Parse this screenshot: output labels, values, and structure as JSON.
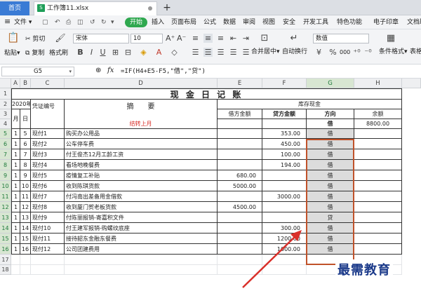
{
  "tabs": {
    "home": "首页",
    "document": "工作簿11.xlsx",
    "add": "+"
  },
  "menu": {
    "hamburger": "≡",
    "file": "文件",
    "items": [
      "开始",
      "插入",
      "页面布局",
      "公式",
      "数据",
      "审阅",
      "视图",
      "安全",
      "开发工具",
      "特色功能",
      "电子印章",
      "文档助"
    ]
  },
  "toolbar": {
    "paste": "粘贴",
    "cut": "剪切",
    "copy": "复制",
    "format_painter": "格式刷",
    "font_name": "宋体",
    "font_size": "10",
    "bold": "B",
    "italic": "I",
    "underline": "U",
    "merge_center": "合并居中",
    "wrap_text": "自动换行",
    "number_format": "数值",
    "percent": "%",
    "thousands": "000",
    "conditional_format": "条件格式",
    "more_format": "表格"
  },
  "formula_bar": {
    "cell_ref": "G5",
    "fx": "fx",
    "formula": "=IF(H4+E5-F5,\"借\",\"贷\")"
  },
  "sheet": {
    "columns": [
      "A",
      "B",
      "C",
      "D",
      "E",
      "F",
      "G",
      "H"
    ],
    "row_numbers": [
      "1",
      "2",
      "3",
      "4",
      "5",
      "6",
      "7",
      "8",
      "9",
      "10",
      "11",
      "12",
      "13",
      "14",
      "15",
      "16",
      "17",
      "18"
    ],
    "title": "现 金 日 记 账",
    "header": {
      "year": "2020年",
      "month": "月",
      "day": "日",
      "voucher": "凭证编号",
      "summary": "摘　　要",
      "ledger": "库存现金",
      "debit": "借方金额",
      "credit": "贷方金额",
      "direction": "方向",
      "balance": "余额"
    },
    "carry_forward": {
      "label": "结转上月",
      "direction": "借",
      "balance": "8800.00"
    },
    "rows": [
      {
        "month": "1",
        "day": "5",
        "voucher": "现付1",
        "summary": "购买办公用品",
        "debit": "",
        "credit": "353.00",
        "direction": "借"
      },
      {
        "month": "1",
        "day": "6",
        "voucher": "现付2",
        "summary": "公车停车费",
        "debit": "",
        "credit": "450.00",
        "direction": "借"
      },
      {
        "month": "1",
        "day": "7",
        "voucher": "现付3",
        "summary": "付王俊杰12月工龄工资",
        "debit": "",
        "credit": "100.00",
        "direction": "借"
      },
      {
        "month": "1",
        "day": "8",
        "voucher": "现付4",
        "summary": "看场地晚餐费",
        "debit": "",
        "credit": "194.00",
        "direction": "借"
      },
      {
        "month": "1",
        "day": "9",
        "voucher": "现付5",
        "summary": "疫情复工补贴",
        "debit": "680.00",
        "credit": "",
        "direction": "借"
      },
      {
        "month": "1",
        "day": "10",
        "voucher": "现付6",
        "summary": "收到陈琪货款",
        "debit": "5000.00",
        "credit": "",
        "direction": "借"
      },
      {
        "month": "1",
        "day": "11",
        "voucher": "现付7",
        "summary": "付冯南出差备用金借款",
        "debit": "",
        "credit": "3000.00",
        "direction": "借"
      },
      {
        "month": "1",
        "day": "12",
        "voucher": "现付8",
        "summary": "收到厦门贺老板货款",
        "debit": "4500.00",
        "credit": "",
        "direction": "借"
      },
      {
        "month": "1",
        "day": "13",
        "voucher": "现付9",
        "summary": "付陈丽报销-寄嘉积文件",
        "debit": "",
        "credit": "",
        "direction": "贷"
      },
      {
        "month": "1",
        "day": "14",
        "voucher": "现付10",
        "summary": "付王建军报销-购螺纹底座",
        "debit": "",
        "credit": "300.00",
        "direction": "借"
      },
      {
        "month": "1",
        "day": "15",
        "voucher": "现付11",
        "summary": "接待韶东金融东餐费",
        "debit": "",
        "credit": "1200.00",
        "direction": "借"
      },
      {
        "month": "1",
        "day": "16",
        "voucher": "现付12",
        "summary": "公司团建费用",
        "debit": "",
        "credit": "1000.00",
        "direction": "借"
      }
    ]
  },
  "watermark": "最需教育",
  "colors": {
    "accent": "#2fa84f",
    "home_tab": "#3a7bd5",
    "selection": "#c0522a",
    "arrow": "#d9302a",
    "carry_forward": "#d9302a"
  }
}
